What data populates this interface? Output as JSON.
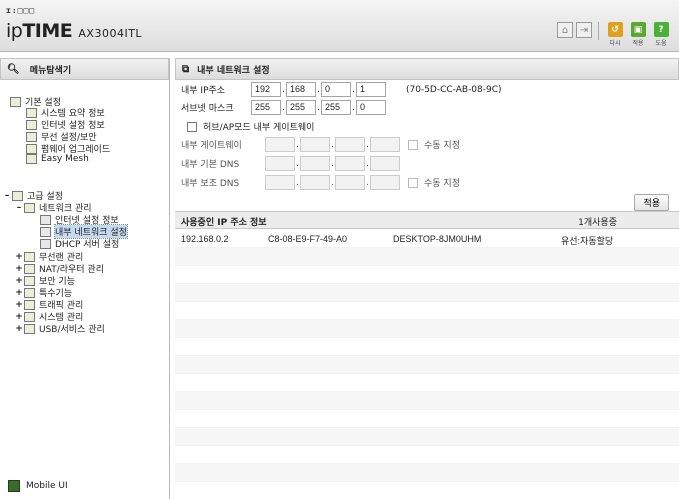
{
  "header": {
    "logo_dots": "ɪ:□□□",
    "brand_ip": "ip",
    "brand_time": "TIME",
    "model": "AX3004ITL",
    "buttons": [
      {
        "label": "다시",
        "icon": "refresh-icon",
        "color": "#e0a020"
      },
      {
        "label": "적용",
        "icon": "save-icon",
        "color": "#5aa832"
      },
      {
        "label": "도움",
        "icon": "help-icon",
        "color": "#4caf3a"
      }
    ]
  },
  "sidebar": {
    "title": "메뉴탐색기",
    "basic": {
      "label": "기본 설정",
      "items": [
        "시스템 요약 정보",
        "인터넷 설정 정보",
        "무선 설정/보안",
        "펌웨어 업그레이드",
        "Easy Mesh"
      ]
    },
    "advanced": {
      "label": "고급 설정",
      "network": {
        "label": "네트워크 관리",
        "items": [
          "인터넷 설정 정보",
          "내부 네트워크 설정",
          "DHCP 서버 설정"
        ],
        "selected_index": 1
      },
      "groups": [
        "무선랜 관리",
        "NAT/라우터 관리",
        "보안 기능",
        "특수기능",
        "트래픽 관리",
        "시스템 관리",
        "USB/서비스 관리"
      ]
    },
    "mobile_label": "Mobile UI"
  },
  "main": {
    "title": "내부 네트워크 설정",
    "ip_label": "내부 IP주소",
    "ip": [
      "192",
      "168",
      "0",
      "1"
    ],
    "mac": "(70-5D-CC-AB-08-9C)",
    "mask_label": "서브넷 마스크",
    "mask": [
      "255",
      "255",
      "255",
      "0"
    ],
    "hub_label": "허브/AP모드 내부 게이트웨이",
    "gateway_label": "내부 게이트웨이",
    "manual_label": "수동 지정",
    "dns1_label": "내부 기본 DNS",
    "dns2_label": "내부 보조 DNS",
    "apply_label": "적용",
    "table_title": "사용중인 IP 주소 정보",
    "table_count": "1개사용중",
    "rows": [
      {
        "ip": "192.168.0.2",
        "mac": "C8-08-E9-F7-49-A0",
        "name": "DESKTOP-8JM0UHM",
        "type": "유선:자동할당"
      }
    ]
  }
}
